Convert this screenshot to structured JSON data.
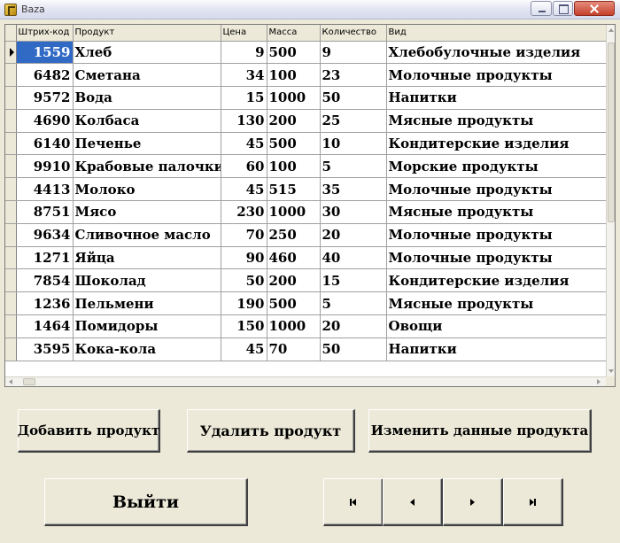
{
  "window": {
    "title": "Baza"
  },
  "grid": {
    "columns": [
      "Штрих-код",
      "Продукт",
      "Цена",
      "Масса",
      "Количество",
      "Вид"
    ],
    "selected_row": 0,
    "rows": [
      {
        "barcode": "1559",
        "product": "Хлеб",
        "price": "9",
        "mass": "500",
        "quantity": "9",
        "kind": "Хлебобулочные изделия"
      },
      {
        "barcode": "6482",
        "product": "Сметана",
        "price": "34",
        "mass": "100",
        "quantity": "23",
        "kind": "Молочные продукты"
      },
      {
        "barcode": "9572",
        "product": "Вода",
        "price": "15",
        "mass": "1000",
        "quantity": "50",
        "kind": "Напитки"
      },
      {
        "barcode": "4690",
        "product": "Колбаса",
        "price": "130",
        "mass": "200",
        "quantity": "25",
        "kind": "Мясные продукты"
      },
      {
        "barcode": "6140",
        "product": "Печенье",
        "price": "45",
        "mass": "500",
        "quantity": "10",
        "kind": "Кондитерские изделия"
      },
      {
        "barcode": "9910",
        "product": "Крабовые палочки",
        "price": "60",
        "mass": "100",
        "quantity": "5",
        "kind": "Морские продукты"
      },
      {
        "barcode": "4413",
        "product": "Молоко",
        "price": "45",
        "mass": "515",
        "quantity": "35",
        "kind": "Молочные продукты"
      },
      {
        "barcode": "8751",
        "product": "Мясо",
        "price": "230",
        "mass": "1000",
        "quantity": "30",
        "kind": "Мясные продукты"
      },
      {
        "barcode": "9634",
        "product": "Сливочное масло",
        "price": "70",
        "mass": "250",
        "quantity": "20",
        "kind": "Молочные продукты"
      },
      {
        "barcode": "1271",
        "product": "Яйца",
        "price": "90",
        "mass": "460",
        "quantity": "40",
        "kind": "Молочные продукты"
      },
      {
        "barcode": "7854",
        "product": "Шоколад",
        "price": "50",
        "mass": "200",
        "quantity": "15",
        "kind": "Кондитерские изделия"
      },
      {
        "barcode": "1236",
        "product": "Пельмени",
        "price": "190",
        "mass": "500",
        "quantity": "5",
        "kind": "Мясные продукты"
      },
      {
        "barcode": "1464",
        "product": "Помидоры",
        "price": "150",
        "mass": "1000",
        "quantity": "20",
        "kind": "Овощи"
      },
      {
        "barcode": "3595",
        "product": "Кока-кола",
        "price": "45",
        "mass": "70",
        "quantity": "50",
        "kind": "Напитки"
      }
    ]
  },
  "buttons": {
    "add": "Добавить продукт",
    "delete": "Удалить продукт",
    "edit": "Изменить данные продукта",
    "exit": "Выйти"
  },
  "navigator": {
    "icons": [
      "first-record-icon",
      "prior-record-icon",
      "next-record-icon",
      "last-record-icon"
    ]
  },
  "colors": {
    "selection": "#316ac5",
    "face": "#ece9d8"
  }
}
